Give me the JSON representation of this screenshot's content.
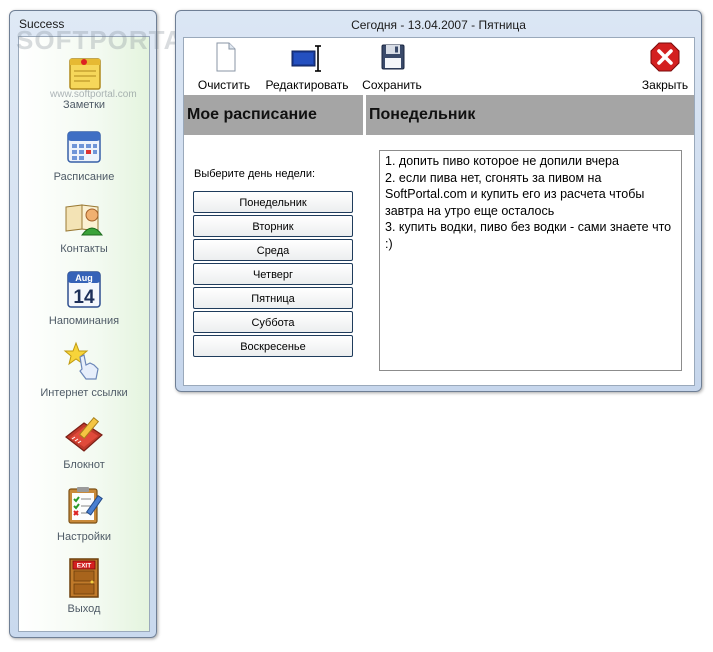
{
  "sidebar": {
    "title": "Success",
    "watermark": "SOFTPORTAL",
    "watermark_url": "www.softportal.com",
    "items": [
      {
        "label": "Заметки",
        "icon": "notes-icon"
      },
      {
        "label": "Расписание",
        "icon": "calendar-icon"
      },
      {
        "label": "Контакты",
        "icon": "contacts-icon"
      },
      {
        "label": "Напоминания",
        "icon": "reminder-calendar-icon"
      },
      {
        "label": "Интернет ссылки",
        "icon": "star-hand-icon"
      },
      {
        "label": "Блокнот",
        "icon": "notebook-pencil-icon"
      },
      {
        "label": "Настройки",
        "icon": "clipboard-checklist-icon"
      },
      {
        "label": "Выход",
        "icon": "exit-door-icon"
      }
    ],
    "calendar_icon_month": "Aug",
    "calendar_icon_day": "14",
    "exit_sign_text": "EXIT"
  },
  "window": {
    "title": "Сегодня - 13.04.2007 - Пятница"
  },
  "toolbar": {
    "clear_label": "Очистить",
    "edit_label": "Редактировать",
    "save_label": "Сохранить",
    "close_label": "Закрыть"
  },
  "schedule": {
    "header_left": "Мое расписание",
    "header_right": "Понедельник",
    "prompt": "Выберите день недели:",
    "days": [
      "Понедельник",
      "Вторник",
      "Среда",
      "Четверг",
      "Пятница",
      "Суббота",
      "Воскресенье"
    ],
    "notes_lines": [
      "1. допить пиво которое не допили вчера",
      "2. если пива нет, сгонять за пивом на SoftPortal.com и купить его из расчета чтобы завтра на утро еще осталось",
      "3. купить водки, пиво без водки - сами знаете что :)"
    ]
  },
  "colors": {
    "header_bg": "#a5a5a5",
    "window_frame": "#c6d6ec",
    "close_red": "#d32020",
    "button_border": "#1f3c5c"
  }
}
